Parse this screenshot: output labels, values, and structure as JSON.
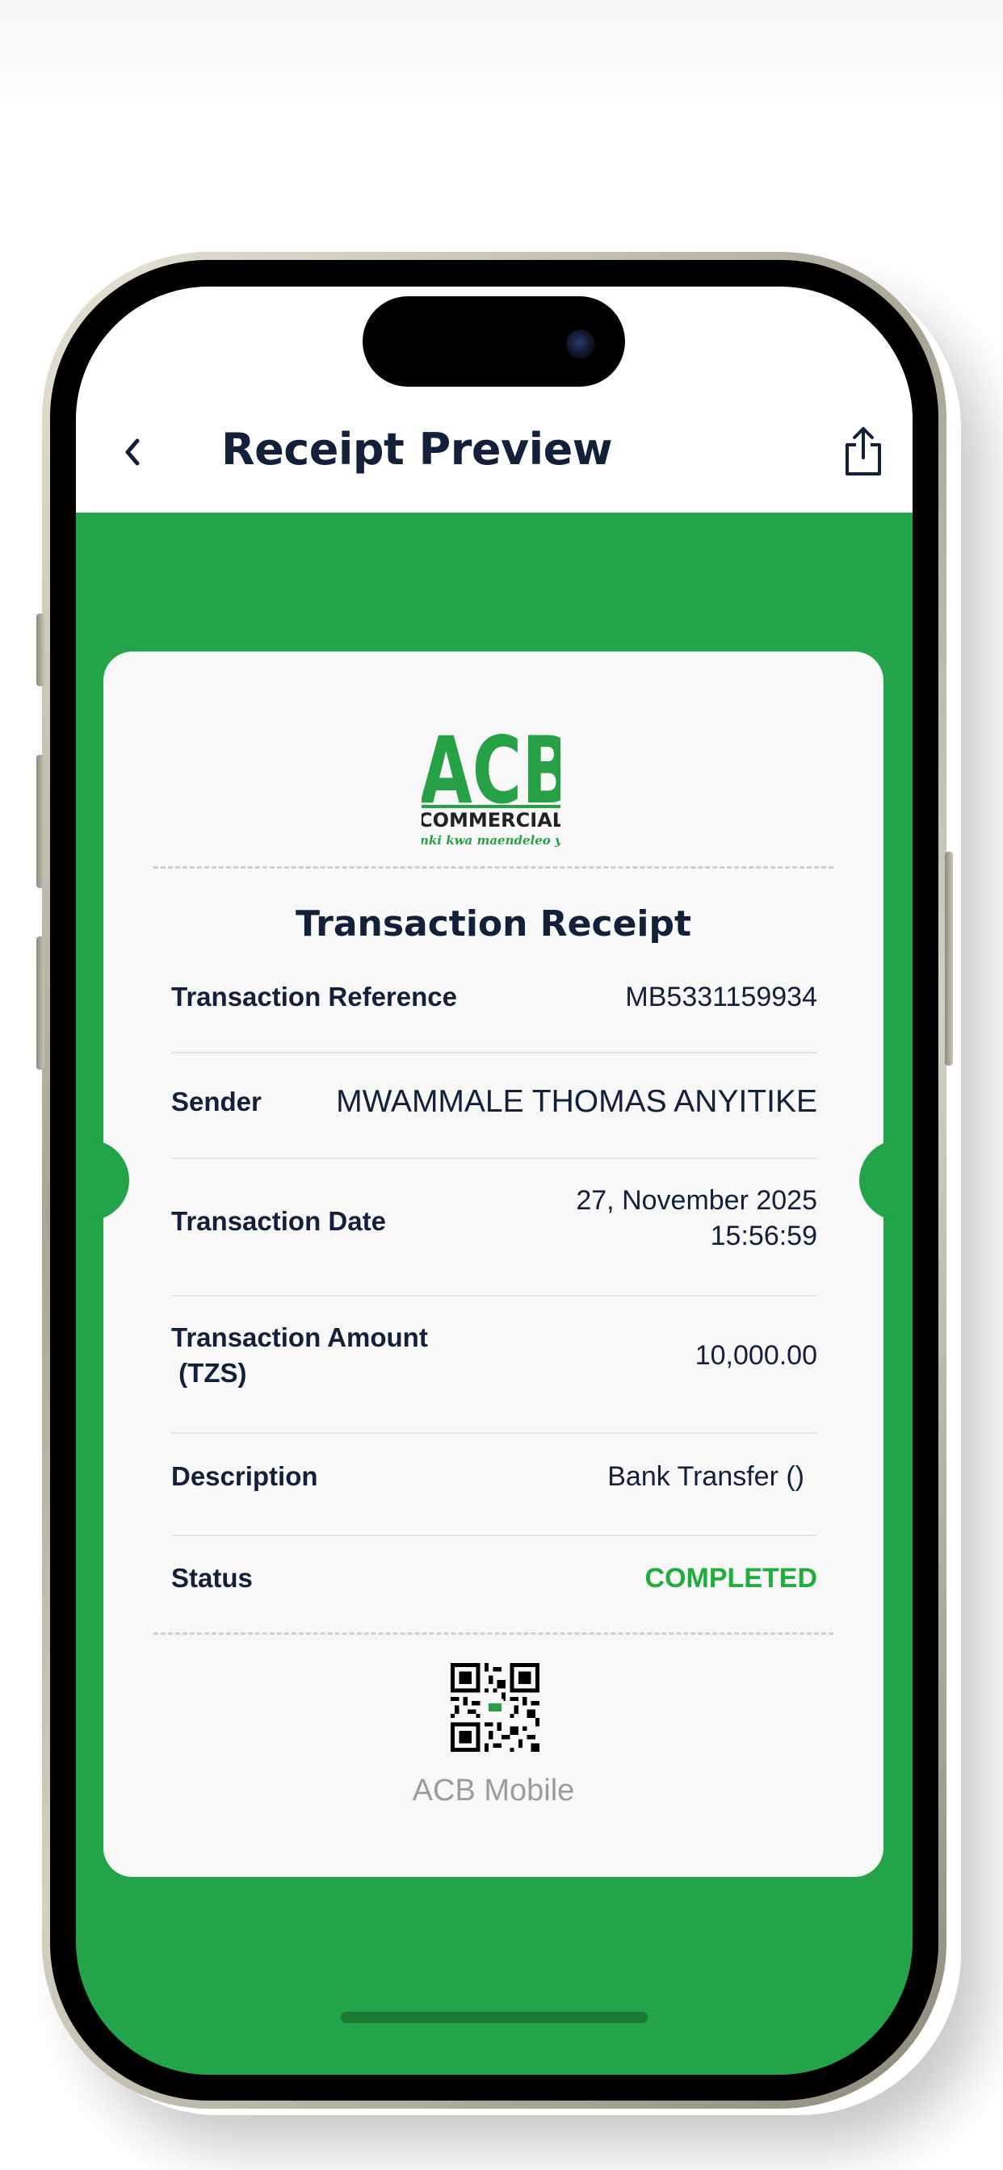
{
  "header": {
    "title": "Receipt Preview",
    "back_icon": "chevron-left-icon",
    "share_icon": "share-icon"
  },
  "receipt": {
    "logo": {
      "mark": "ACB",
      "name": "COMMERCIAL BA",
      "tagline": "nki kwa maendeleo ya"
    },
    "title": "Transaction Receipt",
    "rows": [
      {
        "label": "Transaction Reference",
        "value": "MB5331159934"
      },
      {
        "label": "Sender",
        "value": "MWAMMALE THOMAS ANYITIKE"
      },
      {
        "label": "Transaction Date",
        "value_line1": "27, November 2025",
        "value_line2": "15:56:59"
      },
      {
        "label_line1": "Transaction Amount",
        "label_line2": " (TZS)",
        "value": "10,000.00"
      },
      {
        "label": "Description",
        "value": "Bank Transfer ()"
      },
      {
        "label": "Status",
        "value": "COMPLETED"
      }
    ],
    "qr_icon": "qr-code-icon",
    "footer": "ACB Mobile"
  },
  "colors": {
    "brand_green": "#23a34a",
    "status_green": "#1fae3c",
    "text_dark": "#13203a",
    "card_bg": "#f8f8f8"
  }
}
